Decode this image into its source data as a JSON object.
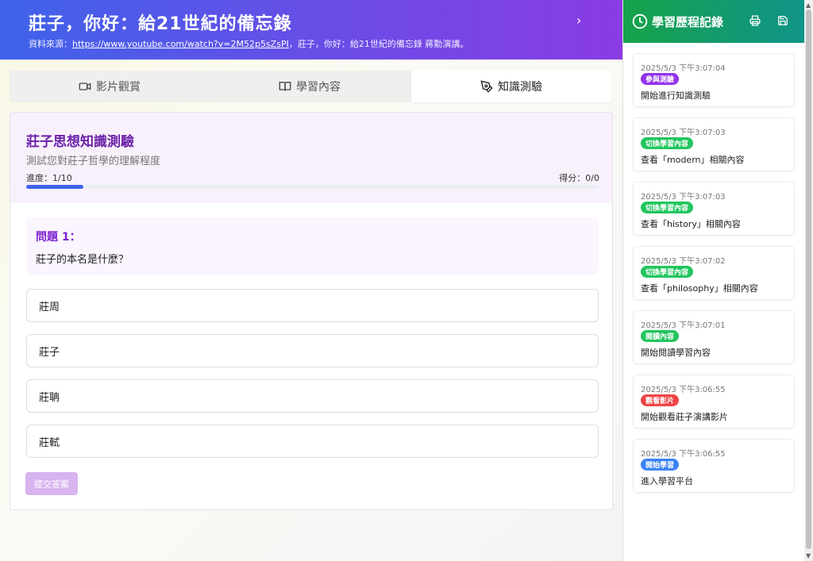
{
  "header": {
    "title": "莊子，你好：給21世紀的備忘錄",
    "source_prefix": "資料來源：",
    "source_url": "https://www.youtube.com/watch?v=2M52p5sZsPI",
    "source_suffix": "，莊子，你好：給21世紀的備忘錄 蔣勳演講。",
    "expand_icon": "chevron-right-icon"
  },
  "tabs": [
    {
      "label": "影片觀賞",
      "icon": "video-icon"
    },
    {
      "label": "學習內容",
      "icon": "book-icon"
    },
    {
      "label": "知識測驗",
      "icon": "pen-icon"
    }
  ],
  "quiz": {
    "title": "莊子思想知識測驗",
    "subtitle": "測試您對莊子哲學的理解程度",
    "progress_label": "進度：1/10",
    "progress_fraction": 0.1,
    "score_label": "得分：0/0",
    "question_number": "問題 1：",
    "question_text": "莊子的本名是什麼？",
    "options": [
      "莊周",
      "莊子",
      "莊聃",
      "莊軾"
    ],
    "submit_label": "提交答案"
  },
  "sidebar": {
    "title": "學習歷程記錄",
    "entries": [
      {
        "time": "2025/5/3 下午3:07:04",
        "badge": "參與測驗",
        "badge_color": "#9333ea",
        "desc": "開始進行知識測驗"
      },
      {
        "time": "2025/5/3 下午3:07:03",
        "badge": "切換學習內容",
        "badge_color": "#22c55e",
        "desc": "查看「modern」相關內容"
      },
      {
        "time": "2025/5/3 下午3:07:03",
        "badge": "切換學習內容",
        "badge_color": "#22c55e",
        "desc": "查看「history」相關內容"
      },
      {
        "time": "2025/5/3 下午3:07:02",
        "badge": "切換學習內容",
        "badge_color": "#22c55e",
        "desc": "查看「philosophy」相關內容"
      },
      {
        "time": "2025/5/3 下午3:07:01",
        "badge": "閱讀內容",
        "badge_color": "#22c55e",
        "desc": "開始閱讀學習內容"
      },
      {
        "time": "2025/5/3 下午3:06:55",
        "badge": "觀看影片",
        "badge_color": "#ef4444",
        "desc": "開始觀看莊子演講影片"
      },
      {
        "time": "2025/5/3 下午3:06:55",
        "badge": "開始學習",
        "badge_color": "#3b82f6",
        "desc": "進入學習平台"
      }
    ]
  }
}
